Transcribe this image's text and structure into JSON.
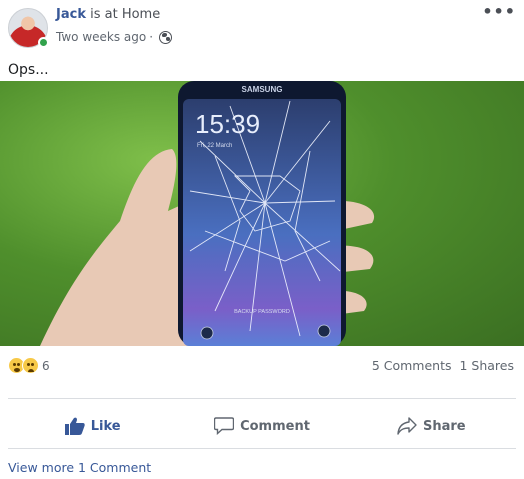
{
  "post": {
    "author": "Jack",
    "activity": "is at Home",
    "timestamp": "Two weeks ago",
    "separator": "·",
    "privacy_icon": "globe-icon",
    "more_icon": "•••",
    "text": "Ops...",
    "photo": {
      "phone_brand": "SAMSUNG",
      "clock": "15:39",
      "date": "Fri, 22 March",
      "lock_hint": "BACKUP PASSWORD"
    }
  },
  "stats": {
    "reaction_count": "6",
    "comments": "5 Comments",
    "shares": "1 Shares"
  },
  "actions": {
    "like": "Like",
    "comment": "Comment",
    "share": "Share"
  },
  "footer": {
    "view_more": "View more 1 Comment"
  },
  "colors": {
    "link": "#385898",
    "online": "#31a24c",
    "divider": "#dadde1"
  }
}
